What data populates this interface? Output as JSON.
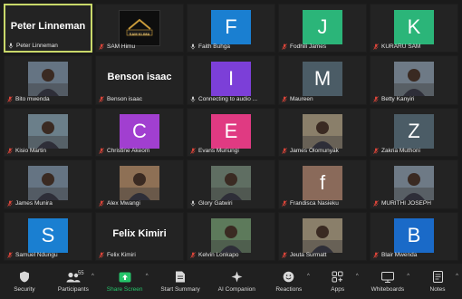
{
  "participants": [
    {
      "name": "Peter Linneman",
      "display": "Peter Linneman",
      "type": "name",
      "active": true
    },
    {
      "name": "SAM Himu",
      "type": "logo",
      "logo_text": "SAM KLIMA",
      "muted": true
    },
    {
      "name": "Faith Buhga",
      "type": "letter",
      "letter": "F",
      "color": "#1a7fd1",
      "muted": false
    },
    {
      "name": "Fodhili James",
      "type": "letter",
      "letter": "J",
      "color": "#2bb579",
      "muted": true
    },
    {
      "name": "KURARU SAM",
      "type": "letter",
      "letter": "K",
      "color": "#2bb579",
      "muted": true
    },
    {
      "name": "Bito mwenda",
      "type": "photo",
      "muted": true
    },
    {
      "name": "Benson isaac",
      "display": "Benson isaac",
      "type": "name",
      "muted": true
    },
    {
      "name": "Connecting to audio ...",
      "type": "letter",
      "letter": "I",
      "color": "#7c3fd8",
      "muted": false
    },
    {
      "name": "Maureen",
      "type": "letter",
      "letter": "M",
      "color": "#4b5c66",
      "muted": true
    },
    {
      "name": "Betty Kanyiri",
      "type": "photo",
      "muted": true
    },
    {
      "name": "Kisio Martin",
      "type": "photo",
      "muted": true
    },
    {
      "name": "Christine Akeom",
      "type": "letter",
      "letter": "C",
      "color": "#a13fd0",
      "muted": true
    },
    {
      "name": "Evans Muriungi",
      "type": "letter",
      "letter": "E",
      "color": "#e03a82",
      "muted": true
    },
    {
      "name": "James Olomunyak",
      "type": "photo",
      "muted": true
    },
    {
      "name": "Zakria Muthoni",
      "type": "letter",
      "letter": "Z",
      "color": "#4b5c66",
      "muted": true
    },
    {
      "name": "James Munira",
      "type": "photo",
      "muted": true
    },
    {
      "name": "Alex Mwangi",
      "type": "photo",
      "muted": true
    },
    {
      "name": "Glory Gatwiri",
      "type": "photo",
      "muted": false
    },
    {
      "name": "Frandisca Nasieku",
      "type": "letter",
      "letter": "f",
      "color": "#8a6a5a",
      "muted": true
    },
    {
      "name": "MURITHI JOSEPH",
      "type": "photo",
      "muted": true
    },
    {
      "name": "Samuel Ndungu",
      "type": "letter",
      "letter": "S",
      "color": "#1a7fd1",
      "muted": true
    },
    {
      "name": "Felix Kimiri",
      "display": "Felix Kimiri",
      "type": "name",
      "muted": true
    },
    {
      "name": "Kelvin Lonkapo",
      "type": "photo",
      "muted": true
    },
    {
      "name": "Jeuta Surmatt",
      "type": "photo",
      "muted": true
    },
    {
      "name": "Blair Mwenda",
      "type": "letter",
      "letter": "B",
      "color": "#1a6ac8",
      "muted": true
    }
  ],
  "toolbar": [
    {
      "label": "Security",
      "icon": "shield-icon",
      "caret": false
    },
    {
      "label": "Participants",
      "icon": "participants-icon",
      "caret": true,
      "count": "55"
    },
    {
      "label": "Share Screen",
      "icon": "share-screen-icon",
      "caret": true,
      "accent": true
    },
    {
      "label": "Start Summary",
      "icon": "summary-icon",
      "caret": false
    },
    {
      "label": "AI Companion",
      "icon": "ai-companion-icon",
      "caret": false
    },
    {
      "label": "Reactions",
      "icon": "reactions-icon",
      "caret": true
    },
    {
      "label": "Apps",
      "icon": "apps-icon",
      "caret": true
    },
    {
      "label": "Whiteboards",
      "icon": "whiteboards-icon",
      "caret": true
    },
    {
      "label": "Notes",
      "icon": "notes-icon",
      "caret": true
    }
  ],
  "colors": {
    "accent": "#25c46a",
    "active_border": "#c9d86a",
    "muted_mic": "#e0463a"
  }
}
